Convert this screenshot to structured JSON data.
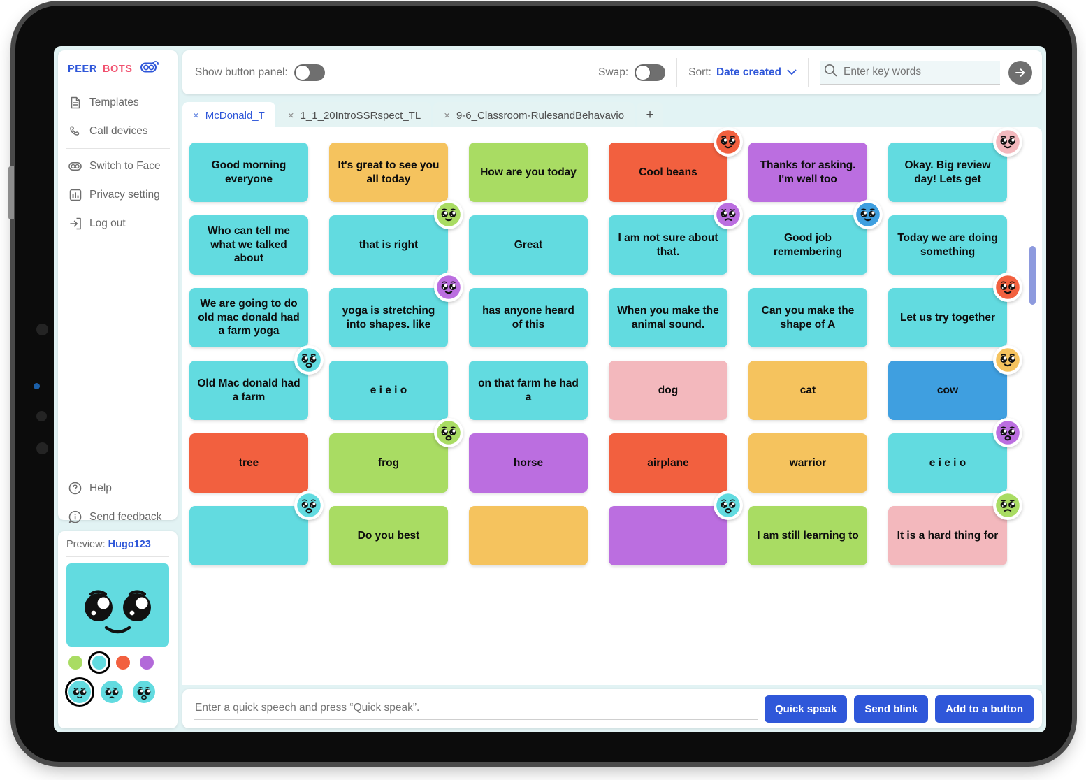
{
  "brand": {
    "word1": "PEER",
    "word2": "BOTS",
    "logo_icon": "robot-logo-icon"
  },
  "sidebar": {
    "group1": [
      {
        "label": "Templates",
        "icon": "document-icon"
      },
      {
        "label": "Call devices",
        "icon": "phone-icon"
      }
    ],
    "group2": [
      {
        "label": "Switch to Face",
        "icon": "face-toggle-icon"
      },
      {
        "label": "Privacy setting",
        "icon": "chart-icon"
      },
      {
        "label": "Log out",
        "icon": "logout-icon"
      }
    ],
    "group3": [
      {
        "label": "Help",
        "icon": "question-circle-icon"
      },
      {
        "label": "Send feedback",
        "icon": "info-bubble-icon"
      }
    ]
  },
  "preview": {
    "label": "Preview:",
    "user": "Hugo123",
    "face_color": "#62dbe0",
    "colors": [
      {
        "name": "green",
        "hex": "#a9dc63",
        "selected": false
      },
      {
        "name": "cyan",
        "hex": "#62dbe0",
        "selected": true
      },
      {
        "name": "orange-red",
        "hex": "#f2603f",
        "selected": false
      },
      {
        "name": "purple",
        "hex": "#b269d9",
        "selected": false
      }
    ],
    "expressions": [
      {
        "name": "happy",
        "selected": true
      },
      {
        "name": "sad",
        "selected": false
      },
      {
        "name": "surprised",
        "selected": false
      }
    ]
  },
  "toolbar": {
    "show_button_panel_label": "Show button panel:",
    "show_button_panel_on": false,
    "swap_label": "Swap:",
    "swap_on": false,
    "sort_label": "Sort:",
    "sort_value": "Date created",
    "sort_chevron_icon": "chevron-down-icon",
    "search_icon": "search-icon",
    "search_value": "",
    "search_placeholder": "Enter key words",
    "search_go_icon": "arrow-right-icon"
  },
  "tabs": {
    "items": [
      {
        "label": "McDonald_T",
        "active": true
      },
      {
        "label": "1_1_20IntroSSRspect_TL",
        "active": false
      },
      {
        "label": "9-6_Classroom-RulesandBehavavio",
        "active": false
      }
    ],
    "add_label": "+"
  },
  "board": {
    "scrollbar": true,
    "tiles": [
      {
        "text": "Good morning everyone",
        "color": "#62dbe0",
        "face": null
      },
      {
        "text": "It's great to see you all today",
        "color": "#f5c35e",
        "face": null
      },
      {
        "text": "How are you today",
        "color": "#a9dc63",
        "face": null
      },
      {
        "text": "Cool beans",
        "color": "#f2603f",
        "face": {
          "color": "#f2603f",
          "mood": "happy"
        }
      },
      {
        "text": "Thanks for asking. I'm well too",
        "color": "#bb6ee0",
        "face": null
      },
      {
        "text": "Okay. Big review day! Lets get",
        "color": "#62dbe0",
        "face": {
          "color": "#f3b8bd",
          "mood": "happy"
        }
      },
      {
        "text": "Who can tell me what we talked about",
        "color": "#62dbe0",
        "face": null
      },
      {
        "text": "that is right",
        "color": "#62dbe0",
        "face": {
          "color": "#a9dc63",
          "mood": "happy"
        }
      },
      {
        "text": "Great",
        "color": "#62dbe0",
        "face": null
      },
      {
        "text": "I am not sure about that.",
        "color": "#62dbe0",
        "face": {
          "color": "#bb6ee0",
          "mood": "sad"
        }
      },
      {
        "text": "Good job remembering",
        "color": "#62dbe0",
        "face": {
          "color": "#3f9fe0",
          "mood": "happy"
        }
      },
      {
        "text": "Today we are doing something",
        "color": "#62dbe0",
        "face": null
      },
      {
        "text": "We are going to do old mac donald had a farm yoga",
        "color": "#62dbe0",
        "face": null
      },
      {
        "text": "yoga is stretching into shapes. like",
        "color": "#62dbe0",
        "face": {
          "color": "#bb6ee0",
          "mood": "happy"
        }
      },
      {
        "text": "has anyone heard of this",
        "color": "#62dbe0",
        "face": null
      },
      {
        "text": "When you make the animal sound.",
        "color": "#62dbe0",
        "face": null
      },
      {
        "text": "Can you make the shape of A",
        "color": "#62dbe0",
        "face": null
      },
      {
        "text": "Let us try together",
        "color": "#62dbe0",
        "face": {
          "color": "#f2603f",
          "mood": "happy"
        }
      },
      {
        "text": "Old Mac donald had a farm",
        "color": "#62dbe0",
        "face": {
          "color": "#62dbe0",
          "mood": "surprised"
        }
      },
      {
        "text": "e i e i o",
        "color": "#62dbe0",
        "face": null
      },
      {
        "text": "on that farm he had a",
        "color": "#62dbe0",
        "face": null
      },
      {
        "text": "dog",
        "color": "#f3b8bd",
        "face": null
      },
      {
        "text": "cat",
        "color": "#f5c35e",
        "face": null
      },
      {
        "text": "cow",
        "color": "#3f9fe0",
        "face": {
          "color": "#f5c35e",
          "mood": "happy"
        }
      },
      {
        "text": "tree",
        "color": "#f2603f",
        "face": null
      },
      {
        "text": "frog",
        "color": "#a9dc63",
        "face": {
          "color": "#a9dc63",
          "mood": "surprised"
        }
      },
      {
        "text": "horse",
        "color": "#bb6ee0",
        "face": null
      },
      {
        "text": "airplane",
        "color": "#f2603f",
        "face": null
      },
      {
        "text": "warrior",
        "color": "#f5c35e",
        "face": null
      },
      {
        "text": "e i e i o",
        "color": "#62dbe0",
        "face": {
          "color": "#bb6ee0",
          "mood": "surprised"
        }
      },
      {
        "text": "",
        "color": "#62dbe0",
        "face": {
          "color": "#62dbe0",
          "mood": "surprised"
        }
      },
      {
        "text": "Do you best",
        "color": "#a9dc63",
        "face": null
      },
      {
        "text": "",
        "color": "#f5c35e",
        "face": null
      },
      {
        "text": "",
        "color": "#bb6ee0",
        "face": {
          "color": "#62dbe0",
          "mood": "surprised"
        }
      },
      {
        "text": "I am still learning to",
        "color": "#a9dc63",
        "face": null
      },
      {
        "text": "It is a hard thing for",
        "color": "#f3b8bd",
        "face": {
          "color": "#a9dc63",
          "mood": "sad"
        }
      }
    ]
  },
  "bottom": {
    "input_value": "",
    "input_placeholder": "Enter a quick speech and press “Quick speak”.",
    "quick_speak": "Quick speak",
    "send_blink": "Send blink",
    "add_to_button": "Add to a button"
  }
}
